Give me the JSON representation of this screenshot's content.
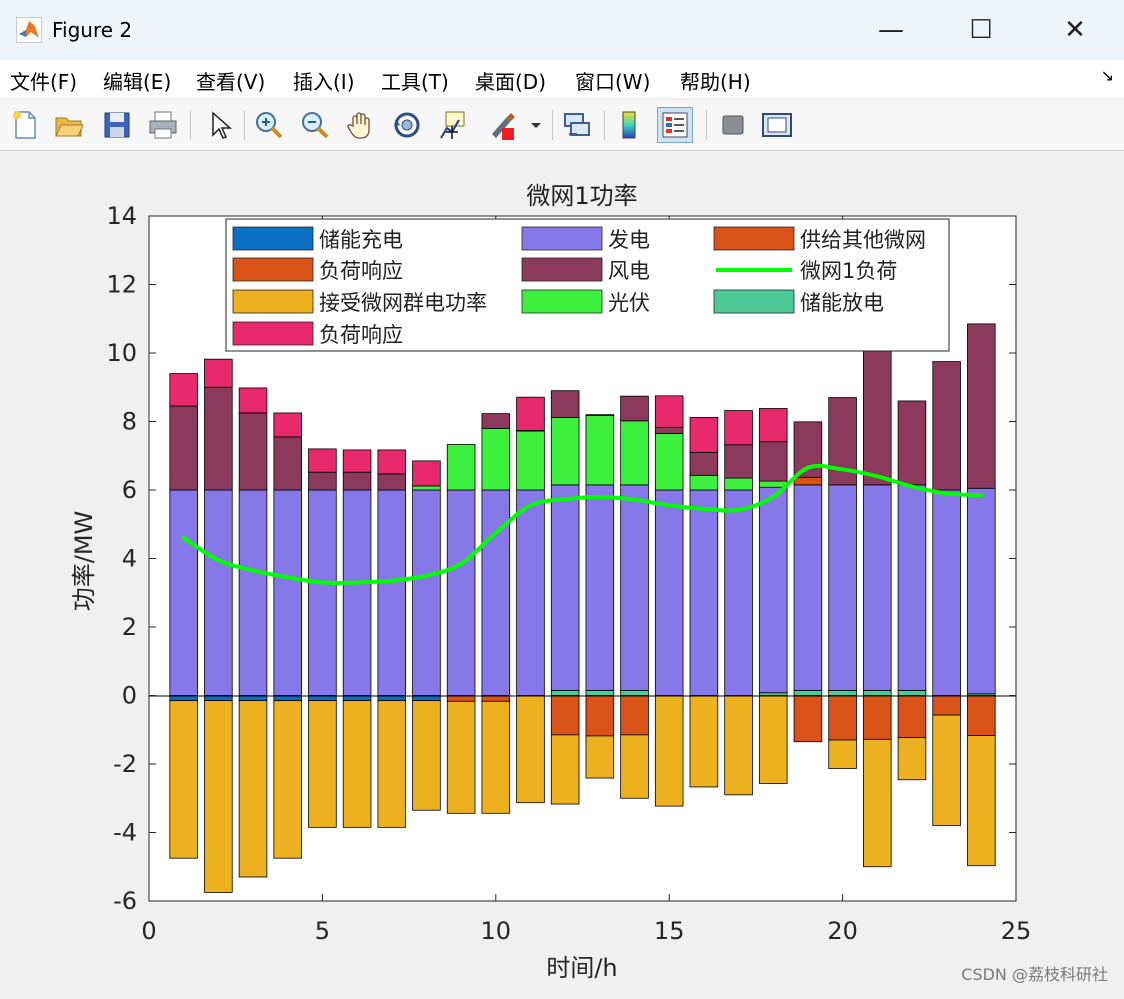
{
  "window": {
    "title": "Figure 2",
    "minimize_glyph": "—",
    "maximize_glyph": "☐",
    "close_glyph": "✕"
  },
  "menu": [
    "文件(F)",
    "编辑(E)",
    "查看(V)",
    "插入(I)",
    "工具(T)",
    "桌面(D)",
    "窗口(W)",
    "帮助(H)"
  ],
  "menu_expand_glyph": "↘",
  "toolbar": [
    {
      "name": "new-figure-icon"
    },
    {
      "name": "open-file-icon"
    },
    {
      "name": "save-icon"
    },
    {
      "name": "print-icon"
    },
    {
      "name": "pointer-icon"
    },
    {
      "name": "zoom-in-icon"
    },
    {
      "name": "zoom-out-icon"
    },
    {
      "name": "pan-hand-icon"
    },
    {
      "name": "rotate-3d-icon"
    },
    {
      "name": "data-cursor-icon"
    },
    {
      "name": "brush-icon"
    },
    {
      "name": "link-icon"
    },
    {
      "name": "colorbar-icon"
    },
    {
      "name": "legend-icon"
    },
    {
      "name": "hide-plot-tools-icon"
    },
    {
      "name": "show-plot-tools-icon"
    }
  ],
  "watermark": "CSDN @荔枝科研社",
  "chart_data": {
    "type": "bar",
    "stacked": true,
    "title": "微网1功率",
    "xlabel": "时间/h",
    "ylabel": "功率/MW",
    "xlim": [
      0,
      25
    ],
    "ylim": [
      -6,
      14
    ],
    "xticks": [
      0,
      5,
      10,
      15,
      20,
      25
    ],
    "yticks": [
      -6,
      -4,
      -2,
      0,
      2,
      4,
      6,
      8,
      10,
      12,
      14
    ],
    "x": [
      1,
      2,
      3,
      4,
      5,
      6,
      7,
      8,
      9,
      10,
      11,
      12,
      13,
      14,
      15,
      16,
      17,
      18,
      19,
      20,
      21,
      22,
      23,
      24
    ],
    "legend_position": "top",
    "legend_order": [
      "储能充电",
      "发电",
      "供给其他微网",
      "负荷响应",
      "风电",
      "微网1负荷",
      "接受微网群电功率",
      "光伏",
      "储能放电",
      "负荷响应"
    ],
    "series_positive": [
      {
        "name": "储能放电",
        "color": "#4dc997",
        "values": [
          0,
          0,
          0,
          0,
          0,
          0,
          0,
          0,
          0,
          0,
          0,
          0.15,
          0.15,
          0.15,
          0,
          0,
          0,
          0.08,
          0.15,
          0.15,
          0.15,
          0.15,
          0,
          0.05
        ]
      },
      {
        "name": "发电",
        "color": "#8778ea",
        "values": [
          6,
          6,
          6,
          6,
          6,
          6,
          6,
          6,
          6,
          6,
          6,
          6,
          6,
          6,
          6,
          6,
          6,
          6,
          6,
          6,
          6,
          6,
          6,
          6
        ]
      },
      {
        "name": "光伏",
        "color": "#3ef03e",
        "values": [
          0,
          0,
          0,
          0,
          0,
          0,
          0,
          0.12,
          1.33,
          1.8,
          1.72,
          1.97,
          2.03,
          1.87,
          1.65,
          0.43,
          0.35,
          0.18,
          0,
          0,
          0,
          0,
          0,
          0
        ]
      },
      {
        "name": "供给其他微网",
        "color": "#d95319",
        "values": [
          0,
          0,
          0,
          0,
          0,
          0,
          0,
          0,
          0,
          0,
          0,
          0,
          0,
          0,
          0,
          0,
          0,
          0,
          0.22,
          0,
          0,
          0,
          0,
          0
        ]
      },
      {
        "name": "风电",
        "color": "#8b3a5c",
        "values": [
          2.45,
          3,
          2.25,
          1.55,
          0.52,
          0.52,
          0.47,
          0,
          0,
          0.43,
          0.02,
          0.78,
          0.02,
          0.72,
          0.18,
          0.67,
          0.97,
          1.15,
          1.62,
          2.55,
          4.2,
          2.45,
          3.75,
          4.8
        ]
      },
      {
        "name": "负荷响应",
        "color": "#e8296c",
        "values": [
          0.95,
          0.82,
          0.73,
          0.7,
          0.68,
          0.65,
          0.7,
          0.73,
          0,
          0,
          0.97,
          0,
          0,
          0,
          0.92,
          1.02,
          1,
          0.97,
          0,
          0,
          0,
          0,
          0,
          0
        ]
      }
    ],
    "series_negative": [
      {
        "name": "储能充电",
        "color": "#0a6ec3",
        "values": [
          -0.15,
          -0.15,
          -0.15,
          -0.15,
          -0.15,
          -0.15,
          -0.15,
          -0.15,
          0,
          0,
          0,
          0,
          0,
          0,
          0,
          0,
          0,
          0,
          0,
          0,
          0,
          0,
          0,
          0
        ]
      },
      {
        "name": "负荷响应",
        "color": "#d95319",
        "values": [
          0,
          0,
          0,
          0,
          0,
          0,
          0,
          0,
          -0.17,
          -0.17,
          0,
          -1.15,
          -1.18,
          -1.15,
          0,
          0,
          0,
          0,
          -1.35,
          -1.3,
          -1.28,
          -1.23,
          -0.57,
          -1.17
        ]
      },
      {
        "name": "接受微网群电功率",
        "color": "#edb120",
        "values": [
          -4.6,
          -5.6,
          -5.15,
          -4.6,
          -3.7,
          -3.7,
          -3.7,
          -3.2,
          -3.27,
          -3.27,
          -3.13,
          -2.02,
          -1.23,
          -1.85,
          -3.23,
          -2.67,
          -2.9,
          -2.57,
          0,
          -0.83,
          -3.72,
          -1.23,
          -3.23,
          -3.8
        ]
      }
    ],
    "line": {
      "name": "微网1负荷",
      "color": "#00ff00",
      "values": [
        4.6,
        3.95,
        3.65,
        3.45,
        3.3,
        3.3,
        3.35,
        3.5,
        3.85,
        4.75,
        5.55,
        5.73,
        5.8,
        5.72,
        5.55,
        5.45,
        5.42,
        5.8,
        6.65,
        6.6,
        6.4,
        6.1,
        5.9,
        5.85
      ]
    }
  }
}
